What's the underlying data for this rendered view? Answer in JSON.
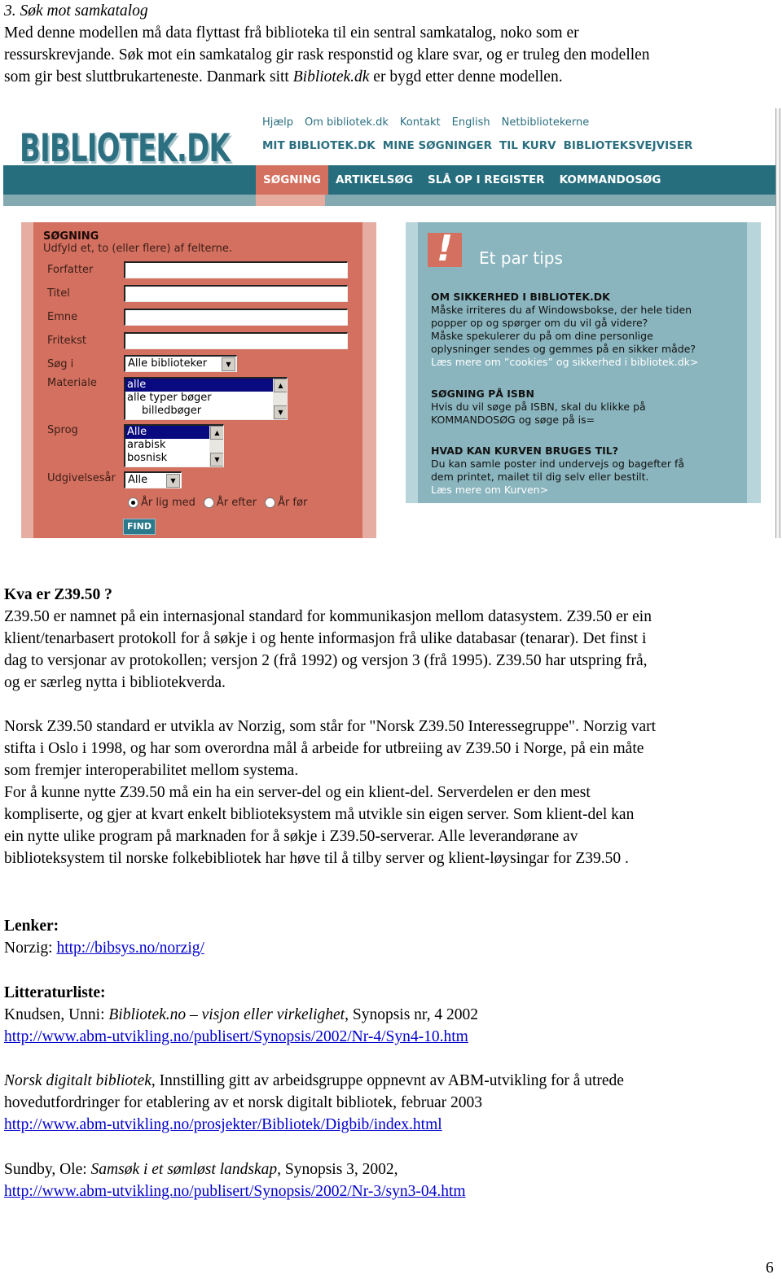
{
  "heading": "3. Søk mot samkatalog",
  "intro": [
    "Med denne modellen må data flyttast frå biblioteka til ein sentral samkatalog, noko som er",
    "ressurskrevjande. Søk mot ein samkatalog gir rask responstid og klare svar, og er truleg den modellen"
  ],
  "intro_last": {
    "before": "som gir best sluttbrukarteneste. Danmark sitt ",
    "italic": "Bibliotek.dk",
    "after": " er bygd etter denne modellen."
  },
  "screenshot": {
    "logo": "BIBLIOTEK.DK",
    "top_links": [
      "Hjælp",
      "Om bibliotek.dk",
      "Kontakt",
      "English",
      "Netbibliotekerne"
    ],
    "main_links": [
      "MIT BIBLIOTEK.DK",
      "MINE SØGNINGER",
      "TIL KURV",
      "BIBLIOTEKSVEJVISER"
    ],
    "tabs": [
      {
        "label": "SØGNING",
        "active": true
      },
      {
        "label": "ARTIKELSØG",
        "active": false
      },
      {
        "label": "SLÅ OP I REGISTER",
        "active": false
      },
      {
        "label": "KOMMANDOSØG",
        "active": false
      }
    ],
    "search": {
      "title": "SØGNING",
      "subtitle": "Udfyld et, to (eller flere) af felterne.",
      "fields": [
        {
          "label": "Forfatter",
          "value": ""
        },
        {
          "label": "Titel",
          "value": ""
        },
        {
          "label": "Emne",
          "value": ""
        },
        {
          "label": "Fritekst",
          "value": ""
        }
      ],
      "sog_i": {
        "label": "Søg i",
        "value": "Alle biblioteker"
      },
      "materiale": {
        "label": "Materiale",
        "options": [
          "alle",
          "alle typer bøger",
          "    billedbøger"
        ],
        "selected": "alle"
      },
      "sprog": {
        "label": "Sprog",
        "options": [
          "Alle",
          "arabisk",
          "bosnisk"
        ],
        "selected": "Alle"
      },
      "udgivelsesaar": {
        "label": "Udgivelsesår",
        "value": "Alle"
      },
      "radios": [
        {
          "label": "År lig med",
          "checked": true
        },
        {
          "label": "År efter",
          "checked": false
        },
        {
          "label": "År før",
          "checked": false
        }
      ],
      "find_label": "FIND"
    },
    "tips": {
      "title": "Et par tips",
      "icon": "exclamation-icon",
      "items": [
        {
          "heading": "OM SIKKERHED I BIBLIOTEK.DK",
          "body": [
            "Måske irriteres du af Windowsbokse, der hele tiden",
            "popper op og spørger om du vil gå videre?",
            "Måske spekulerer du på om dine personlige",
            "oplysninger sendes og gemmes på en sikker måde?"
          ],
          "more": "Læs mere om ”cookies” og sikkerhed i bibliotek.dk>"
        },
        {
          "heading": "SØGNING PÅ ISBN",
          "body": [
            "Hvis du vil søge på ISBN, skal du klikke på",
            "KOMMANDOSØG og søge på is="
          ],
          "more": ""
        },
        {
          "heading": "HVAD KAN KURVEN BRUGES TIL?",
          "body": [
            "Du kan samle poster ind undervejs og bagefter få",
            "dem printet, mailet til dig selv eller bestilt."
          ],
          "more": "Læs mere om Kurven>"
        }
      ]
    }
  },
  "z3950_heading": "Kva er Z39.50 ?",
  "z3950_para": [
    "Z39.50 er namnet på ein internasjonal standard for kommunikasjon mellom datasystem. Z39.50 er ein",
    "klient/tenarbasert protokoll for å søkje i og hente informasjon frå ulike databasar (tenarar). Det finst i",
    "dag to versjonar av protokollen; versjon 2 (frå 1992) og versjon 3 (frå 1995).  Z39.50 har utspring frå,",
    "og er særleg nytta i bibliotekverda."
  ],
  "norzig_para": [
    "Norsk Z39.50 standard er utvikla av Norzig, som står for \"Norsk Z39.50 Interessegruppe\". Norzig vart",
    "stifta i Oslo i 1998, og har som overordna mål å arbeide for utbreiing av Z39.50 i Norge, på ein måte",
    "som fremjer interoperabilitet mellom systema.",
    "For å kunne nytte Z39.50 må ein ha ein server-del og ein klient-del. Serverdelen er den mest",
    "kompliserte, og gjer at kvart enkelt biblioteksystem må utvikle sin eigen server. Som klient-del kan",
    "ein nytte ulike program på marknaden for å søkje i Z39.50-serverar. Alle leverandørane av",
    "biblioteksystem til norske folkebibliotek har høve til å tilby server og klient-løysingar for Z39.50 ."
  ],
  "links_heading": "Lenker:",
  "links": [
    {
      "prefix": "Norzig: ",
      "url": "http://bibsys.no/norzig/"
    }
  ],
  "lit_heading": "Litteraturliste:",
  "literature": [
    {
      "line1_pre": "Knudsen, Unni: ",
      "line1_it": "Bibliotek.no – visjon eller virkelighet",
      "line1_post": ", Synopsis nr, 4 2002",
      "url": "http://www.abm-utvikling.no/publisert/Synopsis/2002/Nr-4/Syn4-10.htm"
    },
    {
      "line1_pre": "",
      "line1_it": "Norsk digitalt bibliotek",
      "line1_post": ", Innstilling gitt av arbeidsgruppe oppnevnt av ABM-utvikling for å utrede",
      "line2": "hovedutfordringer for etablering av et norsk digitalt bibliotek, februar 2003",
      "url": "http://www.abm-utvikling.no/prosjekter/Bibliotek/Digbib/index.html"
    },
    {
      "line1_pre": "Sundby, Ole: ",
      "line1_it": "Samsøk i et sømløst landskap",
      "line1_post": ", Synopsis 3, 2002,",
      "url": "http://www.abm-utvikling.no/publisert/Synopsis/2002/Nr-3/syn3-04.htm"
    }
  ],
  "page_number": "6"
}
